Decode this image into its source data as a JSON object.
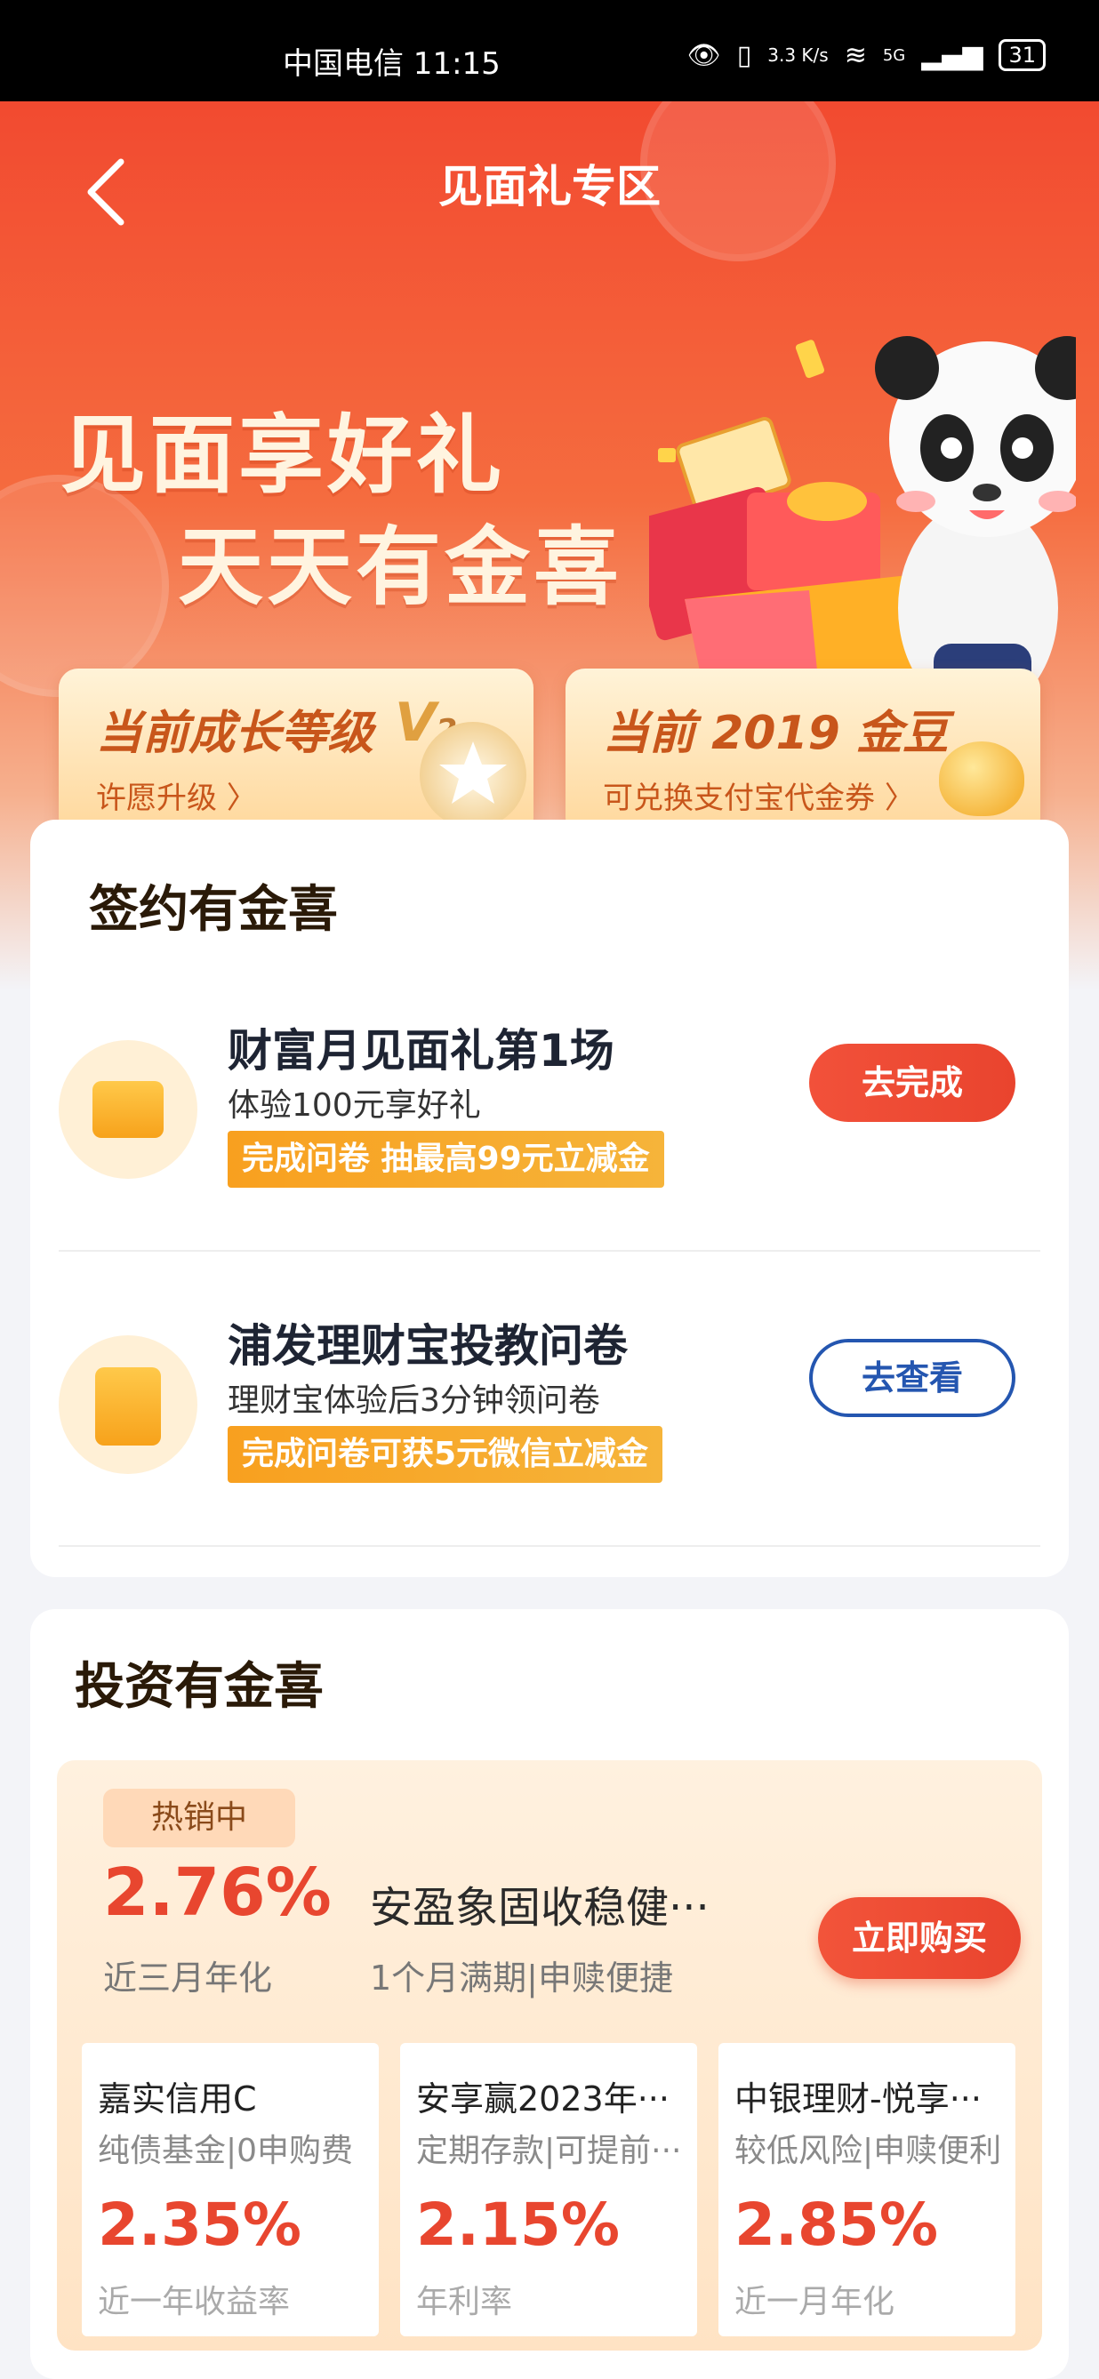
{
  "status_bar": {
    "carrier_time": "中国电信 11:15",
    "speed": "3.3 K/s",
    "signal": "5G",
    "battery": "31"
  },
  "header": {
    "title": "见面礼专区"
  },
  "hero": {
    "slogan_line1": "见面享好礼",
    "slogan_line2": "天天有金喜"
  },
  "level_cards": {
    "growth": {
      "title": "当前成长等级",
      "level_prefix": "V",
      "level_num": "2",
      "sub": "许愿升级 〉"
    },
    "beans": {
      "title": "当前 2019 金豆",
      "sub": "可兑换支付宝代金券 〉"
    }
  },
  "sign_section": {
    "title": "签约有金喜",
    "tasks": [
      {
        "title": "财富月见面礼第1场",
        "sub": "体验100元享好礼",
        "tag": "完成问卷 抽最高99元立减金",
        "button": "去完成"
      },
      {
        "title": "浦发理财宝投教问卷",
        "sub": "理财宝体验后3分钟领问卷",
        "tag": "完成问卷可获5元微信立减金",
        "button": "去查看"
      }
    ]
  },
  "invest_section": {
    "title": "投资有金喜",
    "hot": {
      "badge": "热销中",
      "rate": "2.76%",
      "rate_label": "近三月年化",
      "name": "安盈象固收稳健···",
      "desc": "1个月满期|申赎便捷",
      "button": "立即购买"
    },
    "products": [
      {
        "name": "嘉实信用C",
        "desc": "纯债基金|0申购费",
        "rate": "2.35%",
        "label": "近一年收益率"
      },
      {
        "name": "安享赢2023年···",
        "desc": "定期存款|可提前···",
        "rate": "2.15%",
        "label": "年利率"
      },
      {
        "name": "中银理财-悦享···",
        "desc": "较低风险|申赎便利",
        "rate": "2.85%",
        "label": "近一月年化"
      }
    ]
  }
}
